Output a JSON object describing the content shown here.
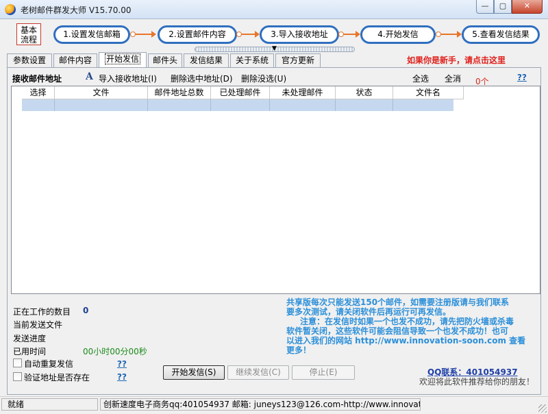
{
  "window": {
    "title": "老树邮件群发大师 V15.70.00",
    "min": "—",
    "max": "▢",
    "close": "✕"
  },
  "workflow": {
    "label_line1": "基本",
    "label_line2": "流程",
    "steps": [
      "1.设置发信邮箱",
      "2.设置邮件内容",
      "3.导入接收地址",
      "4.开始发信",
      "5.查看发信结果"
    ]
  },
  "tabs": [
    "参数设置",
    "邮件内容",
    "开始发信",
    "邮件头",
    "发信结果",
    "关于系统",
    "官方更新"
  ],
  "active_tab": "开始发信",
  "newbie_link": "如果你是新手，请点击这里",
  "toolbar": {
    "section_label": "接收邮件地址",
    "import_icon": "A",
    "import": "导入接收地址(I)",
    "delete_selected": "删除选中地址(D)",
    "delete_unsent": "删除没选(U)",
    "select_all": "全选",
    "deselect_all": "全消",
    "count": "0个",
    "help": "??"
  },
  "table": {
    "columns": [
      "选择",
      "文件",
      "邮件地址总数",
      "已处理邮件",
      "未处理邮件",
      "状态",
      "文件名"
    ],
    "rows": []
  },
  "status": {
    "working_label": "正在工作的数目",
    "working_value": "0",
    "current_file_label": "当前发送文件",
    "progress_label": "发送进度",
    "elapsed_label": "已用时间",
    "elapsed_value": "00小时00分00秒",
    "auto_repeat_label": "自动重复发信",
    "verify_label": "验证地址是否存在",
    "help": "??"
  },
  "notice": {
    "line1": "共享版每次只能发送150个邮件，如需要注册版请与我们联系",
    "line2": "要多次测试，请关闭软件后再运行可再发信。",
    "line3": "注意：在发信时如果一个也发不成功，请先把防火墙或杀毒",
    "line4": "软件暂关闭，这些软件可能会阻信导致一个也发不成功！也可",
    "line5": "以进入我们的网站 http://www.innovation-soon.com 查看",
    "line6": "更多！"
  },
  "buttons": {
    "start": "开始发信(S)",
    "resume": "继续发信(C)",
    "stop": "停止(E)"
  },
  "contact": {
    "qq": "QQ联系：401054937",
    "recommend": "欢迎将此软件推荐给你的朋友！"
  },
  "statusbar": {
    "ready": "就绪",
    "info": "创新速度电子商务qq:401054937 邮箱: juneys123@126.com-http://www.innovation-"
  }
}
